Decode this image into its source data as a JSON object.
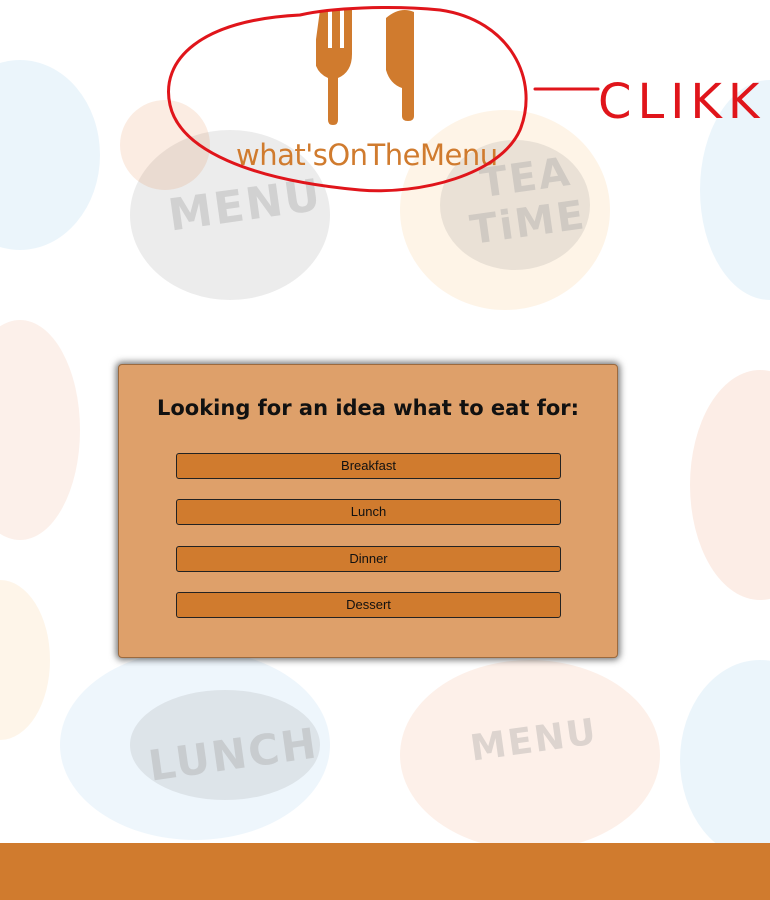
{
  "logo": {
    "text": "what'sOnTheMenu",
    "icon": "fork-knife-icon",
    "color": "#d07b2e"
  },
  "annotation": {
    "text": "CLIKK",
    "color": "#e0151b"
  },
  "card": {
    "title": "Looking for an idea what to eat for:",
    "buttons": [
      "Breakfast",
      "Lunch",
      "Dinner",
      "Dessert"
    ],
    "background": "#dea06a",
    "button_color": "#d07b2e"
  },
  "background_art": {
    "words": [
      "MENU",
      "TEA",
      "TiME",
      "LUNCH",
      "MENU"
    ]
  },
  "footer": {
    "color": "#d07b2e"
  }
}
